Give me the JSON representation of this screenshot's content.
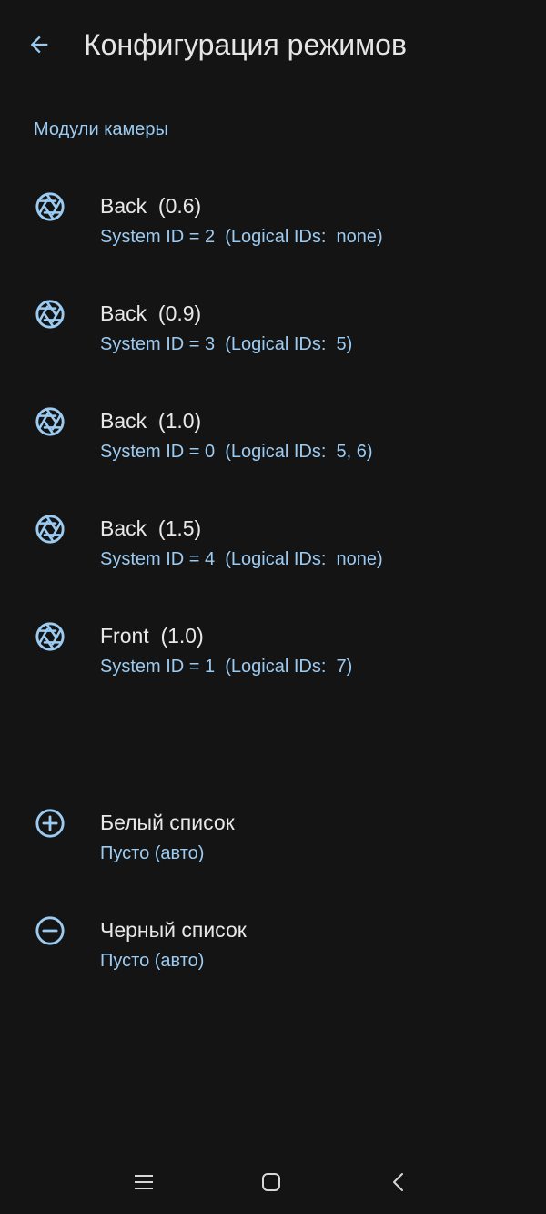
{
  "header": {
    "title": "Конфигурация режимов",
    "back_icon": "arrow-back-icon"
  },
  "section": {
    "title": "Модули камеры"
  },
  "cameras": [
    {
      "title": "Back  (0.6)",
      "subtitle": "System ID = 2  (Logical IDs:  none)",
      "icon": "camera-shutter-icon"
    },
    {
      "title": "Back  (0.9)",
      "subtitle": "System ID = 3  (Logical IDs:  5)",
      "icon": "camera-shutter-icon"
    },
    {
      "title": "Back  (1.0)",
      "subtitle": "System ID = 0  (Logical IDs:  5, 6)",
      "icon": "camera-shutter-icon"
    },
    {
      "title": "Back  (1.5)",
      "subtitle": "System ID = 4  (Logical IDs:  none)",
      "icon": "camera-shutter-icon"
    },
    {
      "title": "Front  (1.0)",
      "subtitle": "System ID = 1  (Logical IDs:  7)",
      "icon": "camera-shutter-icon"
    }
  ],
  "lists": {
    "whitelist": {
      "title": "Белый список",
      "subtitle": "Пусто (авто)",
      "icon": "plus-circle-icon"
    },
    "blacklist": {
      "title": "Черный список",
      "subtitle": "Пусто (авто)",
      "icon": "minus-circle-icon"
    }
  },
  "nav_bar": {
    "recents_icon": "recents-icon",
    "home_icon": "home-icon",
    "back_icon": "back-chevron-icon"
  },
  "colors": {
    "background": "#141414",
    "accent": "#9ccbf2",
    "text_primary": "#e8e8e8"
  }
}
